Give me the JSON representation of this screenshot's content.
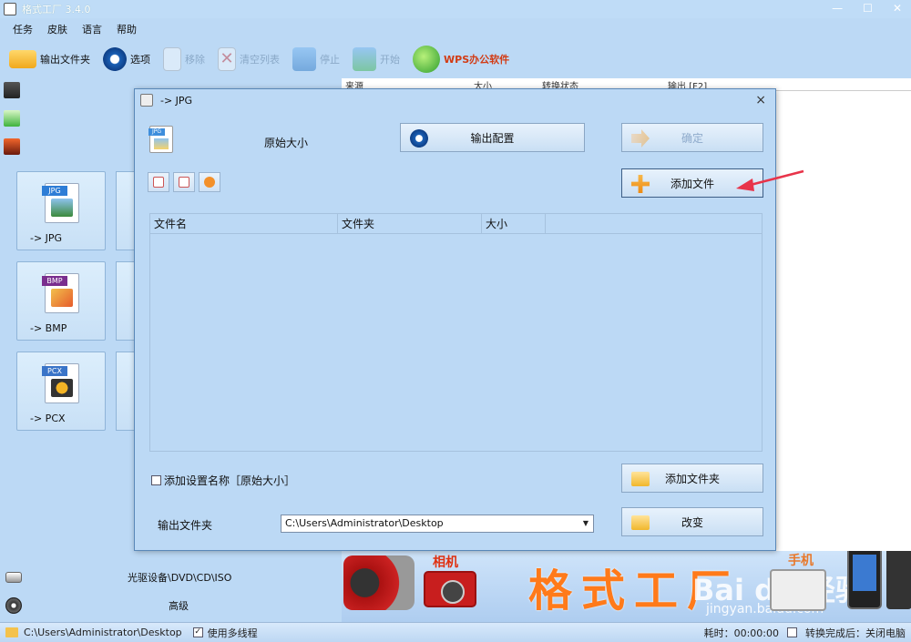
{
  "window": {
    "title": "格式工厂 3.4.0",
    "min": "—",
    "max": "☐",
    "close": "✕"
  },
  "menu": [
    "任务",
    "皮肤",
    "语言",
    "帮助"
  ],
  "toolbar": {
    "output_folder": "输出文件夹",
    "options": "选项",
    "remove": "移除",
    "clear_list": "清空列表",
    "stop": "停止",
    "start": "开始",
    "wps": "WPS办公软件"
  },
  "main_list_header": [
    "来源",
    "大小",
    "转换状态",
    "输出 [F2]"
  ],
  "tiles": [
    {
      "label": "-> JPG",
      "badge": "JPG",
      "badge_color": "#2e7dd6"
    },
    {
      "label": "-> BMP",
      "badge": "BMP",
      "badge_color": "#7a2e8e"
    },
    {
      "label": "-> PCX",
      "badge": "PCX",
      "badge_color": "#3a74c8"
    }
  ],
  "left_bottom": {
    "optical": "光驱设备\\DVD\\CD\\ISO",
    "advanced": "高级"
  },
  "banner": {
    "camera": "相机",
    "slogan": "格式工厂",
    "phone": "手机",
    "watermark": "Bai du 经验",
    "watermark_url": "jingyan.baidu.com"
  },
  "status": {
    "path": "C:\\Users\\Administrator\\Desktop",
    "multithread": "使用多线程",
    "elapsed": "耗时：00:00:00",
    "after_convert": "转换完成后：关闭电脑"
  },
  "dialog": {
    "title": "-> JPG",
    "close": "×",
    "preset": "原始大小",
    "output_config": "输出配置",
    "ok": "确定",
    "add_file": "添加文件",
    "columns": [
      "文件名",
      "文件夹",
      "大小"
    ],
    "add_setting_name": "添加设置名称［原始大小］",
    "add_folder": "添加文件夹",
    "output_folder_label": "输出文件夹",
    "output_folder_value": "C:\\Users\\Administrator\\Desktop",
    "change": "改变"
  },
  "colors": {
    "accent_orange": "#f39a1e",
    "annotation_arrow": "#e8344a"
  }
}
